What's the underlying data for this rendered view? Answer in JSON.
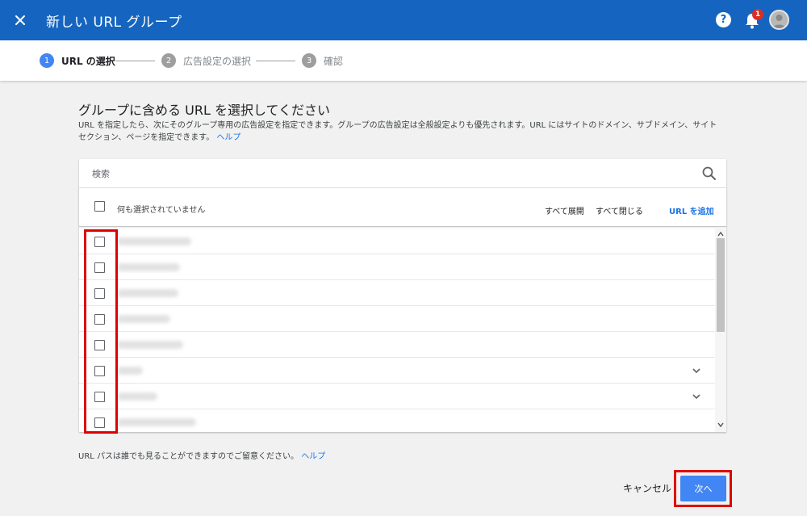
{
  "header": {
    "title": "新しい URL グループ",
    "notification_count": "1",
    "help_label": "?"
  },
  "stepper": {
    "steps": [
      {
        "number": "1",
        "label": "URL の選択",
        "state": "active"
      },
      {
        "number": "2",
        "label": "広告設定の選択",
        "state": "inactive"
      },
      {
        "number": "3",
        "label": "確認",
        "state": "inactive"
      }
    ]
  },
  "main": {
    "heading": "グループに含める URL を選択してください",
    "description": "URL を指定したら、次にそのグループ専用の広告設定を指定できます。グループの広告設定は全般設定よりも優先されます。URL にはサイトのドメイン、サブドメイン、サイト セクション、ページを指定できます。",
    "description_help_link": "ヘルプ"
  },
  "url_list": {
    "search_placeholder": "検索",
    "select_status": "何も選択されていません",
    "expand_all_label": "すべて展開",
    "collapse_all_label": "すべて閉じる",
    "add_url_label": "URL を追加",
    "rows": [
      {
        "text": "",
        "expandable": false
      },
      {
        "text": "",
        "expandable": false
      },
      {
        "text": "",
        "expandable": false
      },
      {
        "text": "",
        "expandable": false
      },
      {
        "text": "",
        "expandable": false
      },
      {
        "text": "",
        "expandable": true
      },
      {
        "text": "",
        "expandable": true
      },
      {
        "text": "",
        "expandable": false
      }
    ]
  },
  "footer": {
    "note": "URL パスは誰でも見ることができますのでご留意ください。",
    "help_link": "ヘルプ",
    "cancel_label": "キャンセル",
    "next_label": "次へ"
  },
  "colors": {
    "topbar": "#1565c0",
    "accent": "#4285f4",
    "link": "#1a73e8",
    "highlight": "#e00000",
    "badge": "#d93025"
  }
}
